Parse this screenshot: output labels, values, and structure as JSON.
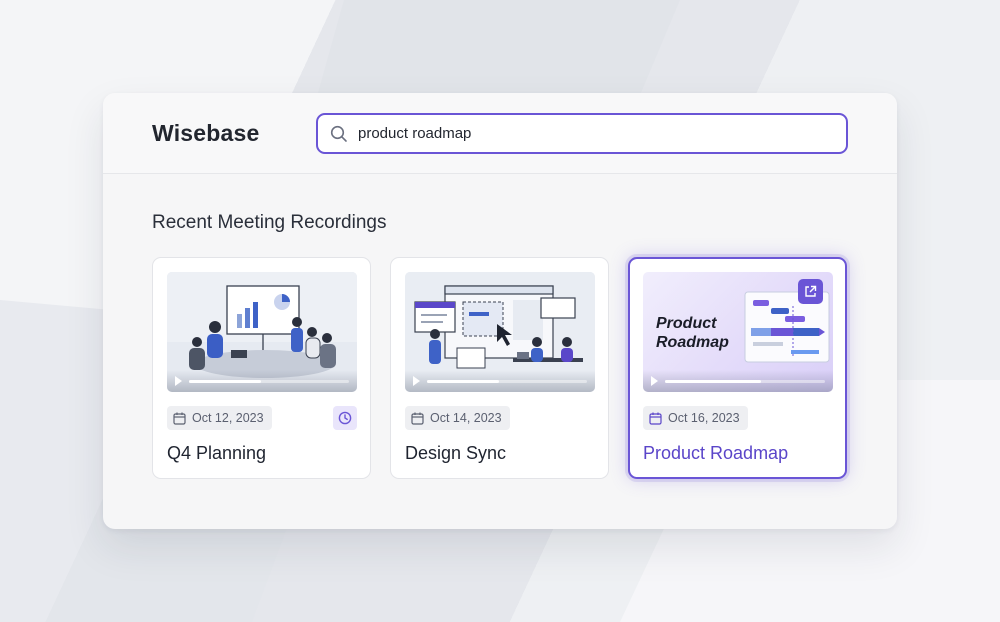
{
  "app": {
    "name": "Wisebase"
  },
  "search": {
    "value": "product roadmap",
    "icon": "search-icon"
  },
  "section": {
    "title": "Recent Meeting Recordings"
  },
  "recordings": [
    {
      "title": "Q4 Planning",
      "date": "Oct 12, 2023",
      "progress": 0.45,
      "has_history": true
    },
    {
      "title": "Design Sync",
      "date": "Oct 14, 2023",
      "progress": 0.45
    },
    {
      "title": "Product Roadmap",
      "date": "Oct 16, 2023",
      "progress": 0.6,
      "selected": true,
      "thumbnail_text": "Product Roadmap"
    }
  ],
  "colors": {
    "accent": "#6a55d6",
    "title_active": "#5a45c9",
    "text": "#1f2430"
  }
}
